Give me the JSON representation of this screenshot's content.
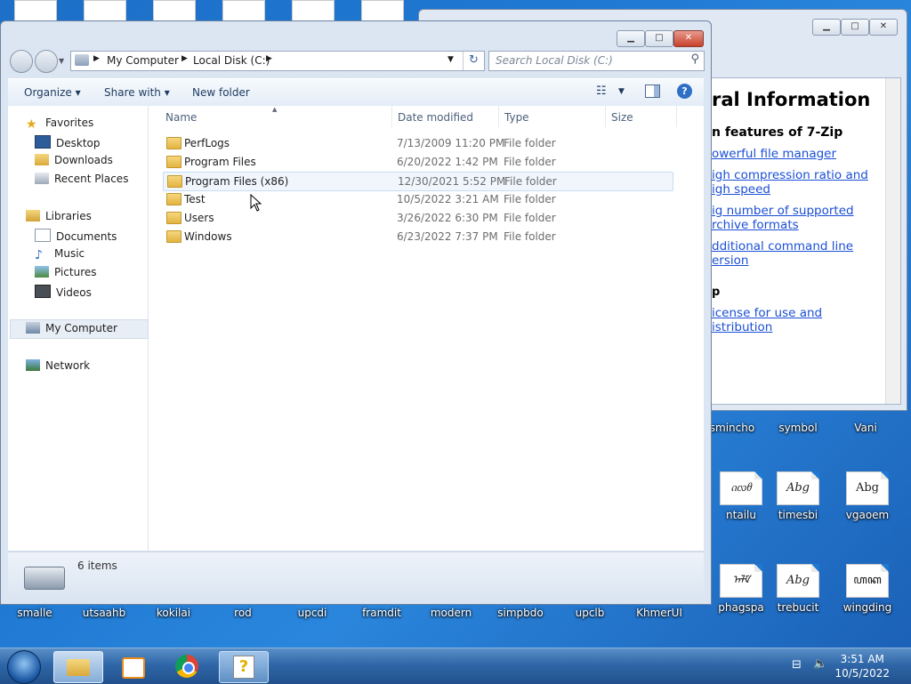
{
  "desktop": {
    "bottom_icons": [
      "smalle",
      "utsaahb",
      "kokilai",
      "rod",
      "upcdi",
      "framdit",
      "modern",
      "simpbdo",
      "upclb",
      "KhmerUI",
      "phagspa",
      "trebucit",
      "wingding"
    ],
    "right_icons_row1": [
      "smincho",
      "symbol",
      "Vani"
    ],
    "right_icons_row2": [
      {
        "label": "ntailu",
        "glyph": "ᦵᦟᦲ"
      },
      {
        "label": "timesbi",
        "glyph": "Abg"
      },
      {
        "label": "vgaoem",
        "glyph": "Abg"
      }
    ],
    "right_icons_row3_glyphs": [
      "ᠠᠯᠮ",
      "Abg",
      "ꦲꦏ"
    ]
  },
  "help_window": {
    "heading": "ral Information",
    "subheading": "n features of 7-Zip",
    "links": [
      "owerful file manager",
      "igh compression ratio and\nigh speed",
      "ig number of supported\nrchive formats",
      "dditional command line\nersion"
    ],
    "subheading2": "p",
    "links2": [
      "icense for use and\nistribution"
    ]
  },
  "explorer": {
    "breadcrumb": [
      "My Computer",
      "Local Disk (C:)"
    ],
    "search_placeholder": "Search Local Disk (C:)",
    "toolbar": {
      "organize": "Organize",
      "share_with": "Share with",
      "new_folder": "New folder"
    },
    "nav": {
      "favorites": "Favorites",
      "desktop": "Desktop",
      "downloads": "Downloads",
      "recent": "Recent Places",
      "libraries": "Libraries",
      "documents": "Documents",
      "music": "Music",
      "pictures": "Pictures",
      "videos": "Videos",
      "computer": "My Computer",
      "network": "Network"
    },
    "columns": {
      "name": "Name",
      "date": "Date modified",
      "type": "Type",
      "size": "Size"
    },
    "files": [
      {
        "name": "PerfLogs",
        "date": "7/13/2009 11:20 PM",
        "type": "File folder"
      },
      {
        "name": "Program Files",
        "date": "6/20/2022 1:42 PM",
        "type": "File folder"
      },
      {
        "name": "Program Files (x86)",
        "date": "12/30/2021 5:52 PM",
        "type": "File folder"
      },
      {
        "name": "Test",
        "date": "10/5/2022 3:21 AM",
        "type": "File folder"
      },
      {
        "name": "Users",
        "date": "3/26/2022 6:30 PM",
        "type": "File folder"
      },
      {
        "name": "Windows",
        "date": "6/23/2022 7:37 PM",
        "type": "File folder"
      }
    ],
    "status": "6 items"
  },
  "taskbar": {
    "time": "3:51 AM",
    "date": "10/5/2022"
  }
}
